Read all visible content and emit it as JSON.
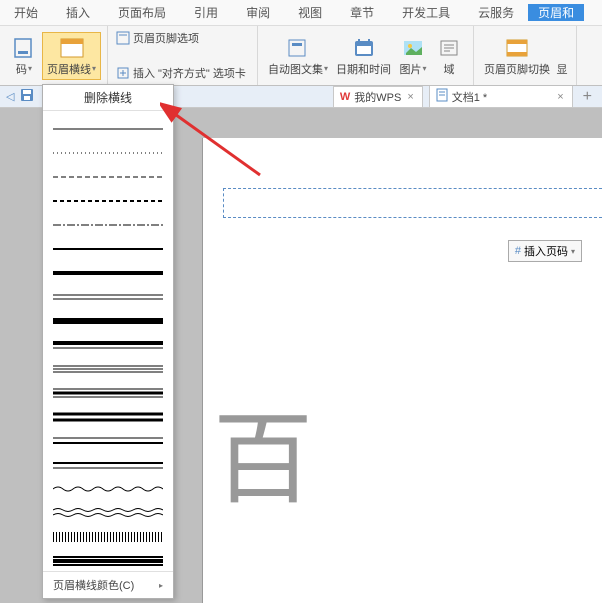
{
  "menu": {
    "items": [
      "开始",
      "插入",
      "页面布局",
      "引用",
      "审阅",
      "视图",
      "章节",
      "开发工具",
      "云服务",
      "页眉和"
    ]
  },
  "ribbon": {
    "pageNumber": "码",
    "headerLine": "页眉横线",
    "headerFooterOpts": "页眉页脚选项",
    "insert": "插入",
    "alignment": "\"对齐方式\"",
    "optionTab": "选项卡",
    "autoImgSet": "自动图文集",
    "dateTime": "日期和时间",
    "picture": "图片",
    "field": "域",
    "headerFooterSwitch": "页眉页脚切换",
    "show": "显"
  },
  "dropdown": {
    "title": "删除横线",
    "patterns": [
      "solid-1",
      "dot-1",
      "dash-1",
      "dash-2",
      "dash-3",
      "solid-2",
      "solid-3",
      "double-1",
      "solid-4",
      "thick-thin",
      "tri-1",
      "tri-2",
      "double-thick",
      "double-2",
      "double-3",
      "wave-1",
      "wave-2",
      "bar-code",
      "dense"
    ],
    "color": "页眉横线颜色(C)"
  },
  "tabs": {
    "wps": "我的WPS",
    "doc": "文档1 *"
  },
  "doc": {
    "insertPageNumber": "插入页码",
    "char": "百"
  }
}
